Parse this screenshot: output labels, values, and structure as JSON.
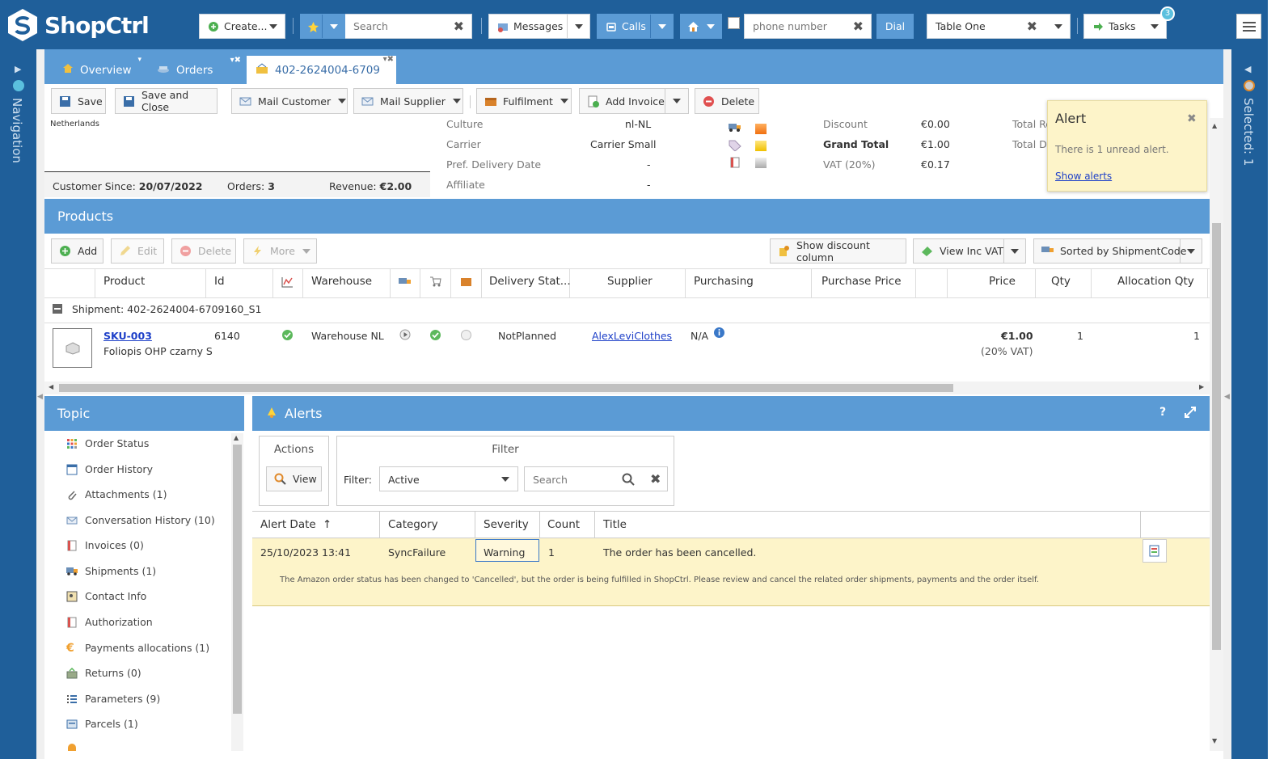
{
  "app": {
    "name": "ShopCtrl"
  },
  "topbar": {
    "create_label": "Create...",
    "search_placeholder": "Search",
    "messages_label": "Messages",
    "calls_label": "Calls",
    "phone_placeholder": "phone number",
    "dial_label": "Dial",
    "table_value": "Table One",
    "tasks_label": "Tasks",
    "tasks_badge": "3"
  },
  "side": {
    "left_label": "Navigation",
    "right_label": "Selected: 1"
  },
  "tabs": [
    {
      "label": "Overview"
    },
    {
      "label": "Orders"
    },
    {
      "label": "402-2624004-6709"
    }
  ],
  "toolbar": {
    "save": "Save",
    "save_close": "Save and Close",
    "mail_customer": "Mail Customer",
    "mail_supplier": "Mail Supplier",
    "fulfilment": "Fulfilment",
    "add_invoice": "Add Invoice",
    "delete": "Delete"
  },
  "customer": {
    "country": "Netherlands",
    "since_label": "Customer Since:",
    "since_value": "20/07/2022",
    "orders_label": "Orders:",
    "orders_value": "3",
    "revenue_label": "Revenue:",
    "revenue_value": "€2.00"
  },
  "info": {
    "culture_label": "Culture",
    "culture_value": "nl-NL",
    "carrier_label": "Carrier",
    "carrier_value": "Carrier Small",
    "delivery_label": "Pref. Delivery Date",
    "delivery_value": "-",
    "affiliate_label": "Affiliate",
    "affiliate_value": "-"
  },
  "totals": {
    "discount_label": "Discount",
    "discount_value": "€0.00",
    "grand_label": "Grand Total",
    "grand_value": "€1.00",
    "vat_label": "VAT (20%)",
    "vat_value": "€0.17",
    "total_re": "Total Re",
    "total_du": "Total Du"
  },
  "alert_popup": {
    "title": "Alert",
    "message": "There is 1 unread alert.",
    "link": "Show alerts"
  },
  "products": {
    "title": "Products",
    "add": "Add",
    "edit": "Edit",
    "delete": "Delete",
    "more": "More",
    "show_discount": "Show discount column",
    "view_vat": "View Inc VAT",
    "sorted": "Sorted by ShipmentCode",
    "columns": {
      "product": "Product",
      "id": "Id",
      "warehouse": "Warehouse",
      "delivery": "Delivery Stat...",
      "supplier": "Supplier",
      "purchasing": "Purchasing",
      "purchase_price": "Purchase Price",
      "price": "Price",
      "qty": "Qty",
      "alloc": "Allocation Qty"
    },
    "shipment": "Shipment: 402-2624004-6709160_S1",
    "row": {
      "sku": "SKU-003",
      "name": "Foliopis OHP czarny S",
      "id": "6140",
      "warehouse": "Warehouse NL",
      "delivery": "NotPlanned",
      "supplier": "AlexLeviClothes",
      "purchasing": "N/A",
      "price": "€1.00",
      "vat_note": "(20% VAT)",
      "qty": "1",
      "alloc": "1"
    }
  },
  "topic": {
    "title": "Topic",
    "items": [
      {
        "label": "Order Status"
      },
      {
        "label": "Order History"
      },
      {
        "label": "Attachments (1)"
      },
      {
        "label": "Conversation History (10)"
      },
      {
        "label": "Invoices (0)"
      },
      {
        "label": "Shipments (1)"
      },
      {
        "label": "Contact Info"
      },
      {
        "label": "Authorization"
      },
      {
        "label": "Payments allocations (1)"
      },
      {
        "label": "Returns (0)"
      },
      {
        "label": "Parameters (9)"
      },
      {
        "label": "Parcels (1)"
      }
    ]
  },
  "alerts": {
    "title": "Alerts",
    "actions_label": "Actions",
    "view": "View",
    "filter_label": "Filter",
    "filter_field_label": "Filter:",
    "filter_value": "Active",
    "search_placeholder": "Search",
    "columns": {
      "date": "Alert Date",
      "category": "Category",
      "severity": "Severity",
      "count": "Count",
      "title": "Title"
    },
    "row": {
      "date": "25/10/2023 13:41",
      "category": "SyncFailure",
      "severity": "Warning",
      "count": "1",
      "title": "The order has been cancelled.",
      "detail": "The Amazon order status has been changed to 'Cancelled', but the order is being fulfilled in ShopCtrl. Please review and cancel the related order shipments, payments and the order itself."
    }
  },
  "colors": {
    "brand": "#1f5f9a",
    "accent": "#5b9bd5",
    "alert_bg": "#fdf4c9"
  }
}
